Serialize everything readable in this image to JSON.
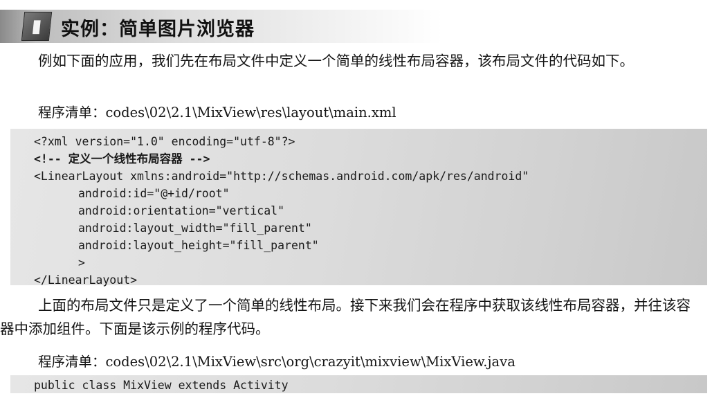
{
  "section": {
    "icon": "book-icon",
    "title": "实例：简单图片浏览器"
  },
  "paragraphs": [
    "例如下面的应用，我们先在布局文件中定义一个简单的线性布局容器，该布局文件的代码如下。",
    "上面的布局文件只是定义了一个简单的线性布局。接下来我们会在程序中获取该线性布局容器，并往该容器中添加组件。下面是该示例的程序代码。"
  ],
  "listings": [
    "程序清单：codes\\02\\2.1\\MixView\\res\\layout\\main.xml",
    "程序清单：codes\\02\\2.1\\MixView\\src\\org\\crazyit\\mixview\\MixView.java"
  ],
  "code_xml": [
    "<?xml version=\"1.0\" encoding=\"utf-8\"?>",
    "<!-- 定义一个线性布局容器 -->",
    "<LinearLayout xmlns:android=\"http://schemas.android.com/apk/res/android\"",
    "android:id=\"@+id/root\"",
    "android:orientation=\"vertical\"",
    "android:layout_width=\"fill_parent\"",
    "android:layout_height=\"fill_parent\"",
    ">",
    "</LinearLayout>"
  ],
  "code_java": [
    "public class MixView extends Activity"
  ]
}
